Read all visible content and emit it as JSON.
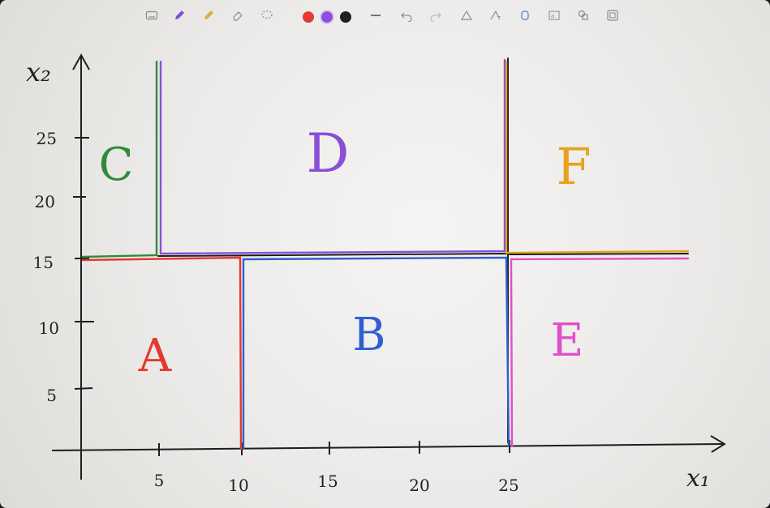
{
  "toolbar": {
    "tools": [
      {
        "icon": "keyboard-icon"
      },
      {
        "icon": "pen-icon"
      },
      {
        "icon": "highlighter-icon"
      },
      {
        "icon": "eraser-icon"
      },
      {
        "icon": "lasso-icon"
      },
      {
        "icon": "line-icon"
      },
      {
        "icon": "undo-icon"
      },
      {
        "icon": "redo-icon"
      },
      {
        "icon": "ink-to-shape-icon"
      },
      {
        "icon": "ink-to-text-icon"
      },
      {
        "icon": "touch-writing-icon"
      },
      {
        "icon": "math-icon"
      },
      {
        "icon": "shapes-icon"
      },
      {
        "icon": "ruler-icon"
      }
    ],
    "colors": [
      "#e53935",
      "#8e4fe0",
      "#202020"
    ]
  },
  "axes": {
    "x_label": "x₁",
    "y_label": "x₂",
    "x_ticks": [
      "5",
      "10",
      "15",
      "20",
      "25"
    ],
    "y_ticks": [
      "5",
      "10",
      "15",
      "20",
      "25"
    ]
  },
  "regions": [
    {
      "label": "A",
      "color": "#e23a2c"
    },
    {
      "label": "B",
      "color": "#2f5fd0"
    },
    {
      "label": "C",
      "color": "#2e8b3a"
    },
    {
      "label": "D",
      "color": "#8a4fd8"
    },
    {
      "label": "E",
      "color": "#e04fc8"
    },
    {
      "label": "F",
      "color": "#e6a21e"
    }
  ]
}
